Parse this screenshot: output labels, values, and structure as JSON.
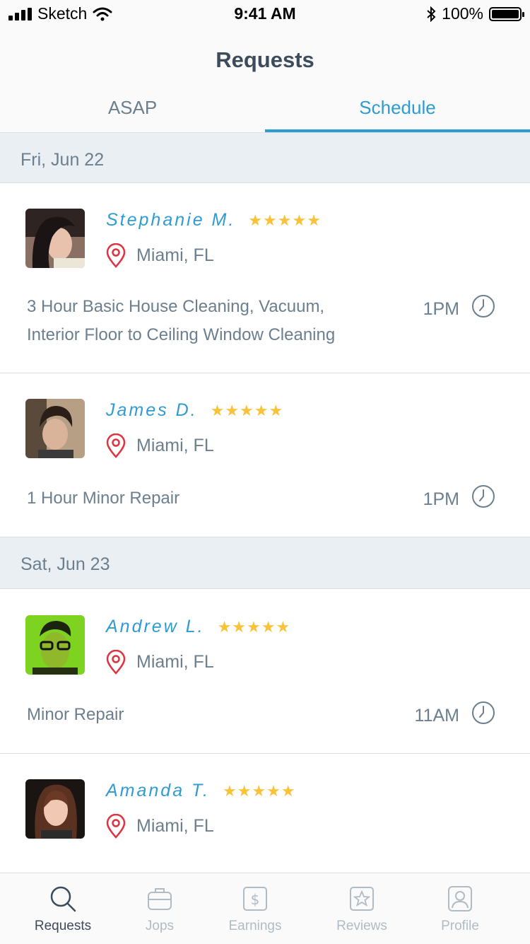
{
  "status_bar": {
    "carrier": "Sketch",
    "time": "9:41 AM",
    "battery": "100%"
  },
  "header": {
    "title": "Requests"
  },
  "tabs": [
    {
      "label": "ASAP"
    },
    {
      "label": "Schedule"
    }
  ],
  "sections": [
    {
      "date": "Fri, Jun 22"
    },
    {
      "date": "Sat, Jun 23"
    }
  ],
  "requests": [
    {
      "name": "Stephanie M.",
      "stars": "★★★★★",
      "location": "Miami, FL",
      "service": "3 Hour Basic House Cleaning, Vacuum, Interior Floor to Ceiling Window Cleaning",
      "time": "1PM"
    },
    {
      "name": "James D.",
      "stars": "★★★★★",
      "location": "Miami, FL",
      "service": "1 Hour Minor Repair",
      "time": "1PM"
    },
    {
      "name": "Andrew L.",
      "stars": "★★★★★",
      "location": "Miami, FL",
      "service": "Minor Repair",
      "time": "11AM"
    },
    {
      "name": "Amanda T.",
      "stars": "★★★★★",
      "location": "Miami, FL",
      "service": "",
      "time": ""
    }
  ],
  "tab_bar": [
    {
      "label": "Requests"
    },
    {
      "label": "Jops"
    },
    {
      "label": "Earnings"
    },
    {
      "label": "Reviews"
    },
    {
      "label": "Profile"
    }
  ],
  "colors": {
    "accent": "#2f9bd3",
    "star": "#f8c33a",
    "pin": "#e1333f",
    "text": "#6b7f8e",
    "title": "#3d4c5c"
  },
  "icons": [
    "signal-icon",
    "wifi-icon",
    "bluetooth-icon",
    "battery-icon",
    "location-pin-icon",
    "clock-icon",
    "search-icon",
    "briefcase-icon",
    "dollar-icon",
    "star-icon",
    "profile-icon"
  ]
}
